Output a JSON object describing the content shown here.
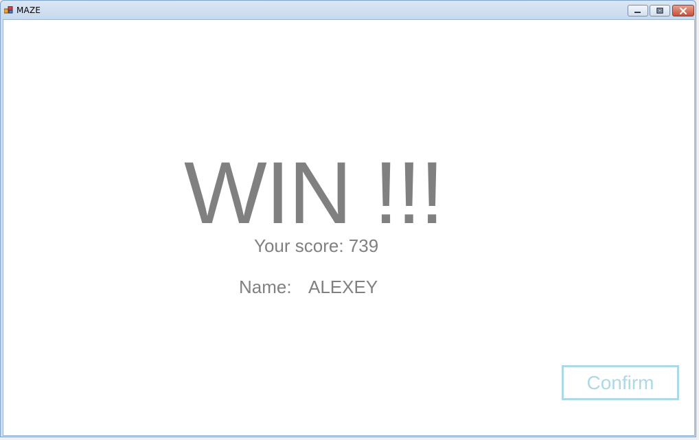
{
  "window": {
    "title": "MAZE",
    "controls": {
      "minimize": "minimize-icon",
      "maximize": "restore-icon",
      "close": "close-icon"
    }
  },
  "result": {
    "heading": "WIN !!!",
    "score_text": "Your score: 739",
    "name_label": "Name:",
    "name_value": "ALEXEY"
  },
  "actions": {
    "confirm_label": "Confirm"
  },
  "colors": {
    "text_gray": "#808080",
    "confirm_accent": "#add8e6",
    "close_button": "#c7503a"
  }
}
